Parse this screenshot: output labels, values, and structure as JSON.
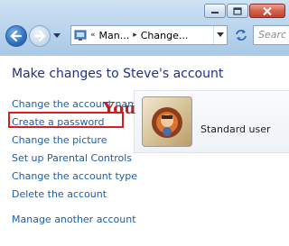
{
  "window": {
    "controls": {
      "minimize": "minimize",
      "maximize": "maximize",
      "close": "close"
    }
  },
  "nav": {
    "breadcrumbs": [
      "Man...",
      "Change..."
    ],
    "search_placeholder": "Searc"
  },
  "main": {
    "title": "Make changes to Steve's account",
    "links": [
      "Change the account name",
      "Create a password",
      "Change the picture",
      "Set up Parental Controls",
      "Change the account type",
      "Delete the account"
    ],
    "other_link": "Manage another account",
    "highlighted_link_index": 1,
    "highlight_color": "#e01b1b"
  },
  "account": {
    "name": "You",
    "type": "Standard user",
    "name_color": "#b5242a"
  },
  "colors": {
    "link": "#1c5ea8",
    "title": "#1e3287",
    "chrome": "#bcd6ee"
  }
}
